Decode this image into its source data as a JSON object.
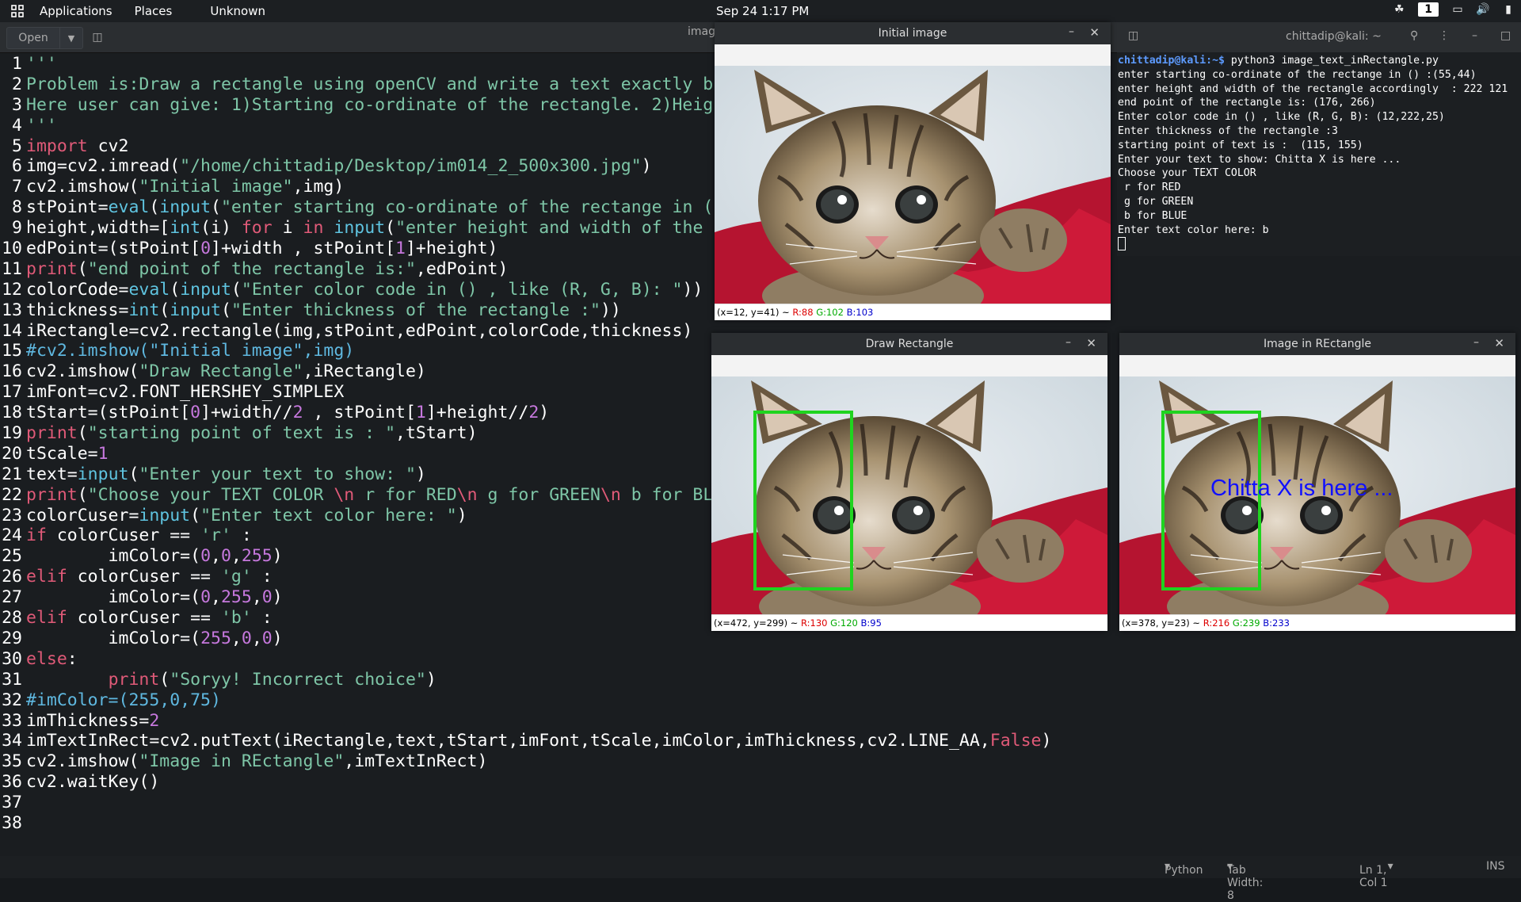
{
  "topbar": {
    "applications": "Applications",
    "places": "Places",
    "unknown": "Unknown",
    "clock": "Sep 24  1:17 PM",
    "workspace": "1"
  },
  "editor": {
    "open_label": "Open",
    "title_fragment": "imag",
    "lines": [
      "'''",
      "Problem is:Draw a rectangle using openCV and write a text exactly b",
      "Here user can give: 1)Starting co-ordinate of the rectangle. 2)Heig",
      "'''",
      "import cv2",
      "img=cv2.imread(\"/home/chittadip/Desktop/im014_2_500x300.jpg\")",
      "cv2.imshow(\"Initial image\",img)",
      "stPoint=eval(input(\"enter starting co-ordinate of the rectange in (",
      "height,width=[int(i) for i in input(\"enter height and width of the",
      "edPoint=(stPoint[0]+width , stPoint[1]+height)",
      "print(\"end point of the rectangle is:\",edPoint)",
      "colorCode=eval(input(\"Enter color code in () , like (R, G, B): \"))",
      "thickness=int(input(\"Enter thickness of the rectangle :\"))",
      "iRectangle=cv2.rectangle(img,stPoint,edPoint,colorCode,thickness)",
      "#cv2.imshow(\"Initial image\",img)",
      "cv2.imshow(\"Draw Rectangle\",iRectangle)",
      "imFont=cv2.FONT_HERSHEY_SIMPLEX",
      "tStart=(stPoint[0]+width//2 , stPoint[1]+height//2)",
      "print(\"starting point of text is : \",tStart)",
      "tScale=1",
      "text=input(\"Enter your text to show: \")",
      "print(\"Choose your TEXT COLOR \\n r for RED\\n g for GREEN\\n b for BL",
      "colorCuser=input(\"Enter text color here: \")",
      "if colorCuser == 'r' :",
      "        imColor=(0,0,255)",
      "elif colorCuser == 'g' :",
      "        imColor=(0,255,0)",
      "elif colorCuser == 'b' :",
      "        imColor=(255,0,0)",
      "else:",
      "        print(\"Soryy! Incorrect choice\")",
      "#imColor=(255,0,75)",
      "imThickness=2",
      "imTextInRect=cv2.putText(iRectangle,text,tStart,imFont,tScale,imColor,imThickness,cv2.LINE_AA,False)",
      "cv2.imshow(\"Image in REctangle\",imTextInRect)",
      "cv2.waitKey()",
      "",
      ""
    ]
  },
  "statusbar": {
    "language": "Python",
    "tab_width": "Tab Width: 8",
    "position": "Ln 1, Col 1",
    "mode": "INS"
  },
  "windows": {
    "initial": {
      "title": "Initial image",
      "coords": "(x=12, y=41) ~",
      "r": "R:88",
      "g": "G:102",
      "b": "B:103"
    },
    "draw": {
      "title": "Draw Rectangle",
      "coords": "(x=472, y=299) ~",
      "r": "R:130",
      "g": "G:120",
      "b": "B:95"
    },
    "inrect": {
      "title": "Image in REctangle",
      "coords": "(x=378, y=23) ~",
      "r": "R:216",
      "g": "G:239",
      "b": "B:233",
      "overlay_text": "Chitta X is here ..."
    }
  },
  "terminal": {
    "title": "chittadip@kali: ~",
    "prompt": "chittadip@kali:~$",
    "command": " python3 image_text_inRectangle.py",
    "output": [
      "enter starting co-ordinate of the rectange in () :(55,44)",
      "enter height and width of the rectangle accordingly  : 222 121",
      "end point of the rectangle is: (176, 266)",
      "Enter color code in () , like (R, G, B): (12,222,25)",
      "Enter thickness of the rectangle :3",
      "starting point of text is :  (115, 155)",
      "Enter your text to show: Chitta X is here ...",
      "Choose your TEXT COLOR",
      " r for RED",
      " g for GREEN",
      " b for BLUE",
      "Enter text color here: b"
    ]
  },
  "colors": {
    "keyword": "#e05a78",
    "string": "#7ec6a7",
    "builtin": "#5fc4e0",
    "number": "#c678dd",
    "rect_green": "#1fd41f",
    "text_blue": "#1010ff"
  }
}
